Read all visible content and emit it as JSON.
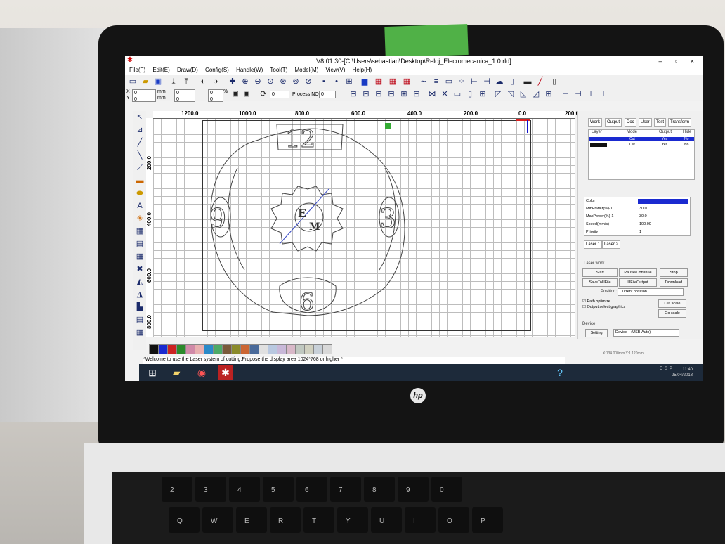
{
  "window": {
    "title": "V8.01.30-[C:\\Users\\sebastian\\Desktop\\Reloj_Elecromecanica_1.0.rld]",
    "controls": "– ▫ ×"
  },
  "menu": [
    "File(F)",
    "Edit(E)",
    "Draw(D)",
    "Config(S)",
    "Handle(W)",
    "Tool(T)",
    "Model(M)",
    "View(V)",
    "Help(H)"
  ],
  "coords": {
    "x_label": "X",
    "x_value": "0",
    "y_label": "Y",
    "y_value": "0",
    "unit_a": "mm",
    "unit_b": "mm",
    "w_value": "0",
    "h_value": "0",
    "pct_a": "0",
    "pct_b": "0",
    "pct": "%",
    "rotate_value": "0",
    "process_label": "Process NO",
    "process_value": "0"
  },
  "ruler": {
    "h": [
      "1200.0",
      "1000.0",
      "800.0",
      "600.0",
      "400.0",
      "200.0",
      "0.0",
      "200.0"
    ],
    "v": [
      "200.0",
      "400.0",
      "600.0",
      "800.0"
    ]
  },
  "drawing": {
    "n12": "12",
    "n3": "3",
    "n6": "6",
    "n9": "9",
    "logo_e": "E",
    "logo_m": "M"
  },
  "palette": [
    "#111111",
    "#1a2ad0",
    "#cc2222",
    "#2b8a2b",
    "#d08aa8",
    "#e8b0b0",
    "#2a8ac8",
    "#4caa66",
    "#7a5a3a",
    "#8a8a2a",
    "#cc6633",
    "#4a6a9a",
    "#e0e0e0",
    "#b8c8e0",
    "#c8b8d8",
    "#d8b8c8",
    "#c0c8c0",
    "#d0d0c0",
    "#c8d0d8",
    "#d8d8d8"
  ],
  "status": {
    "message": "*Welcome to use the Laser system of cutting,Propose the display area 1024*768 or higher *",
    "coord_text": "X:134.000mm,Y:1.120mm"
  },
  "panel": {
    "tabs": [
      "Work",
      "Output",
      "Doc",
      "User",
      "Test",
      "Transform"
    ],
    "layer_headers": [
      "Layer",
      "Mode",
      "Output",
      "Hide"
    ],
    "layers": [
      {
        "color": "#1a2ad0",
        "mode": "Cut",
        "output": "Yes",
        "hide": "No",
        "selected": true
      },
      {
        "color": "#111111",
        "mode": "Cut",
        "output": "Yes",
        "hide": "No",
        "selected": false
      }
    ],
    "props": [
      {
        "label": "Color",
        "value": ""
      },
      {
        "label": "MinPower(%)-1",
        "value": "30.0"
      },
      {
        "label": "MaxPower(%)-1",
        "value": "30.0"
      },
      {
        "label": "Speed(mm/s)",
        "value": "100.00"
      },
      {
        "label": "Priority",
        "value": "1"
      }
    ],
    "laser_tabs": [
      "Laser 1",
      "Laser 2"
    ],
    "laser_work_label": "Laser work",
    "buttons": {
      "start": "Start",
      "pause": "Pause/Continue",
      "stop": "Stop",
      "save": "SaveToUFile",
      "ufile": "UFileOutput",
      "download": "Download",
      "cut_scale": "Cut scale",
      "go_scale": "Go scale",
      "setting": "Setting"
    },
    "position_label": "Position:",
    "position_value": "Current position",
    "path_optimize": "Path optimize",
    "output_select": "Output select graphics",
    "device_label": "Device",
    "device_value": "Device---(USB:Auto)"
  },
  "taskbar": {
    "lang": "ESP",
    "time": "11:40",
    "date": "25/04/2018"
  },
  "keys": [
    "2",
    "3",
    "4",
    "5",
    "6",
    "7",
    "8",
    "9",
    "0",
    "Q",
    "W",
    "E",
    "R",
    "T",
    "Y",
    "U",
    "I",
    "O",
    "P"
  ],
  "logo": "hp"
}
